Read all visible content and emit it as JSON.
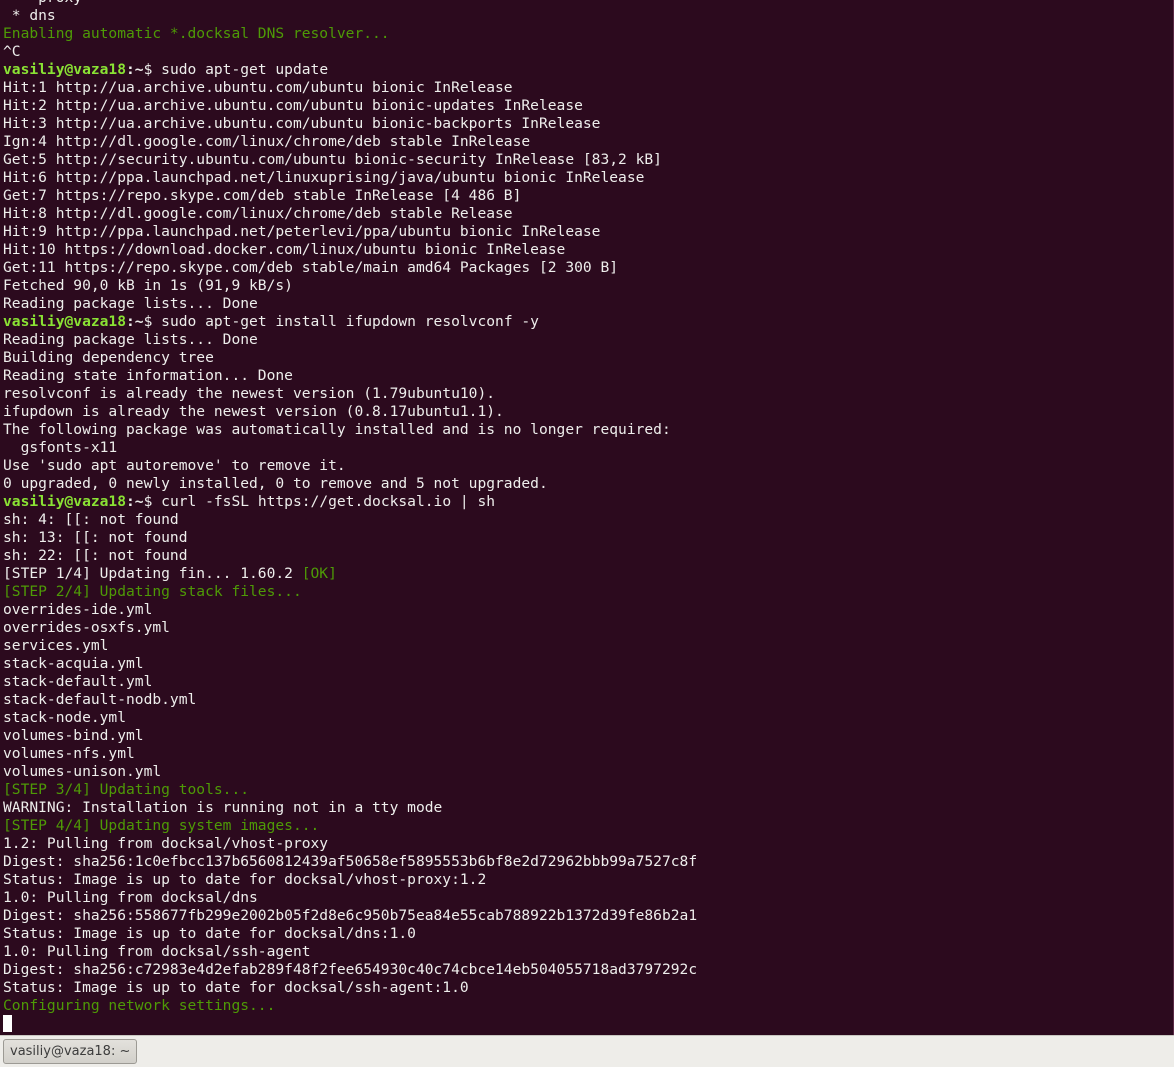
{
  "terminal": {
    "colors": {
      "background": "#2c0a1e",
      "text": "#eeeeec",
      "info": "#4e9a06",
      "prompt_user": "#8ae234"
    },
    "lines": [
      {
        "segments": [
          {
            "t": "    proxy",
            "c": "normal"
          }
        ]
      },
      {
        "segments": [
          {
            "t": " * dns",
            "c": "normal"
          }
        ]
      },
      {
        "segments": [
          {
            "t": "Enabling automatic *.docksal DNS resolver...",
            "c": "green"
          }
        ]
      },
      {
        "segments": [
          {
            "t": "^C",
            "c": "normal"
          }
        ]
      },
      {
        "segments": [
          {
            "t": "vasiliy@vaza18",
            "c": "prompt-user"
          },
          {
            "t": ":~",
            "c": "prompt-path"
          },
          {
            "t": "$ sudo apt-get update",
            "c": "normal"
          }
        ]
      },
      {
        "segments": [
          {
            "t": "Hit:1 http://ua.archive.ubuntu.com/ubuntu bionic InRelease",
            "c": "normal"
          }
        ]
      },
      {
        "segments": [
          {
            "t": "Hit:2 http://ua.archive.ubuntu.com/ubuntu bionic-updates InRelease",
            "c": "normal"
          }
        ]
      },
      {
        "segments": [
          {
            "t": "Hit:3 http://ua.archive.ubuntu.com/ubuntu bionic-backports InRelease",
            "c": "normal"
          }
        ]
      },
      {
        "segments": [
          {
            "t": "Ign:4 http://dl.google.com/linux/chrome/deb stable InRelease",
            "c": "normal"
          }
        ]
      },
      {
        "segments": [
          {
            "t": "Get:5 http://security.ubuntu.com/ubuntu bionic-security InRelease [83,2 kB]",
            "c": "normal"
          }
        ]
      },
      {
        "segments": [
          {
            "t": "Hit:6 http://ppa.launchpad.net/linuxuprising/java/ubuntu bionic InRelease",
            "c": "normal"
          }
        ]
      },
      {
        "segments": [
          {
            "t": "Get:7 https://repo.skype.com/deb stable InRelease [4 486 B]",
            "c": "normal"
          }
        ]
      },
      {
        "segments": [
          {
            "t": "Hit:8 http://dl.google.com/linux/chrome/deb stable Release",
            "c": "normal"
          }
        ]
      },
      {
        "segments": [
          {
            "t": "Hit:9 http://ppa.launchpad.net/peterlevi/ppa/ubuntu bionic InRelease",
            "c": "normal"
          }
        ]
      },
      {
        "segments": [
          {
            "t": "Hit:10 https://download.docker.com/linux/ubuntu bionic InRelease",
            "c": "normal"
          }
        ]
      },
      {
        "segments": [
          {
            "t": "Get:11 https://repo.skype.com/deb stable/main amd64 Packages [2 300 B]",
            "c": "normal"
          }
        ]
      },
      {
        "segments": [
          {
            "t": "Fetched 90,0 kB in 1s (91,9 kB/s)",
            "c": "normal"
          }
        ]
      },
      {
        "segments": [
          {
            "t": "Reading package lists... Done",
            "c": "normal"
          }
        ]
      },
      {
        "segments": [
          {
            "t": "vasiliy@vaza18",
            "c": "prompt-user"
          },
          {
            "t": ":~",
            "c": "prompt-path"
          },
          {
            "t": "$ sudo apt-get install ifupdown resolvconf -y",
            "c": "normal"
          }
        ]
      },
      {
        "segments": [
          {
            "t": "Reading package lists... Done",
            "c": "normal"
          }
        ]
      },
      {
        "segments": [
          {
            "t": "Building dependency tree",
            "c": "normal"
          }
        ]
      },
      {
        "segments": [
          {
            "t": "Reading state information... Done",
            "c": "normal"
          }
        ]
      },
      {
        "segments": [
          {
            "t": "resolvconf is already the newest version (1.79ubuntu10).",
            "c": "normal"
          }
        ]
      },
      {
        "segments": [
          {
            "t": "ifupdown is already the newest version (0.8.17ubuntu1.1).",
            "c": "normal"
          }
        ]
      },
      {
        "segments": [
          {
            "t": "The following package was automatically installed and is no longer required:",
            "c": "normal"
          }
        ]
      },
      {
        "segments": [
          {
            "t": "  gsfonts-x11",
            "c": "normal"
          }
        ]
      },
      {
        "segments": [
          {
            "t": "Use 'sudo apt autoremove' to remove it.",
            "c": "normal"
          }
        ]
      },
      {
        "segments": [
          {
            "t": "0 upgraded, 0 newly installed, 0 to remove and 5 not upgraded.",
            "c": "normal"
          }
        ]
      },
      {
        "segments": [
          {
            "t": "vasiliy@vaza18",
            "c": "prompt-user"
          },
          {
            "t": ":~",
            "c": "prompt-path"
          },
          {
            "t": "$ curl -fsSL https://get.docksal.io | sh",
            "c": "normal"
          }
        ]
      },
      {
        "segments": [
          {
            "t": "sh: 4: [[: not found",
            "c": "normal"
          }
        ]
      },
      {
        "segments": [
          {
            "t": "sh: 13: [[: not found",
            "c": "normal"
          }
        ]
      },
      {
        "segments": [
          {
            "t": "sh: 22: [[: not found",
            "c": "normal"
          }
        ]
      },
      {
        "segments": [
          {
            "t": "[STEP 1/4] Updating fin... 1.60.2 ",
            "c": "normal"
          },
          {
            "t": "[OK]",
            "c": "green"
          }
        ]
      },
      {
        "segments": [
          {
            "t": "[STEP 2/4] Updating stack files...",
            "c": "green"
          }
        ]
      },
      {
        "segments": [
          {
            "t": "overrides-ide.yml",
            "c": "normal"
          }
        ]
      },
      {
        "segments": [
          {
            "t": "overrides-osxfs.yml",
            "c": "normal"
          }
        ]
      },
      {
        "segments": [
          {
            "t": "services.yml",
            "c": "normal"
          }
        ]
      },
      {
        "segments": [
          {
            "t": "stack-acquia.yml",
            "c": "normal"
          }
        ]
      },
      {
        "segments": [
          {
            "t": "stack-default.yml",
            "c": "normal"
          }
        ]
      },
      {
        "segments": [
          {
            "t": "stack-default-nodb.yml",
            "c": "normal"
          }
        ]
      },
      {
        "segments": [
          {
            "t": "stack-node.yml",
            "c": "normal"
          }
        ]
      },
      {
        "segments": [
          {
            "t": "volumes-bind.yml",
            "c": "normal"
          }
        ]
      },
      {
        "segments": [
          {
            "t": "volumes-nfs.yml",
            "c": "normal"
          }
        ]
      },
      {
        "segments": [
          {
            "t": "volumes-unison.yml",
            "c": "normal"
          }
        ]
      },
      {
        "segments": [
          {
            "t": "[STEP 3/4] Updating tools...",
            "c": "green"
          }
        ]
      },
      {
        "segments": [
          {
            "t": "WARNING: Installation is running not in a tty mode",
            "c": "normal"
          }
        ]
      },
      {
        "segments": [
          {
            "t": "[STEP 4/4] Updating system images...",
            "c": "green"
          }
        ]
      },
      {
        "segments": [
          {
            "t": "1.2: Pulling from docksal/vhost-proxy",
            "c": "normal"
          }
        ]
      },
      {
        "segments": [
          {
            "t": "Digest: sha256:1c0efbcc137b6560812439af50658ef5895553b6bf8e2d72962bbb99a7527c8f",
            "c": "normal"
          }
        ]
      },
      {
        "segments": [
          {
            "t": "Status: Image is up to date for docksal/vhost-proxy:1.2",
            "c": "normal"
          }
        ]
      },
      {
        "segments": [
          {
            "t": "1.0: Pulling from docksal/dns",
            "c": "normal"
          }
        ]
      },
      {
        "segments": [
          {
            "t": "Digest: sha256:558677fb299e2002b05f2d8e6c950b75ea84e55cab788922b1372d39fe86b2a1",
            "c": "normal"
          }
        ]
      },
      {
        "segments": [
          {
            "t": "Status: Image is up to date for docksal/dns:1.0",
            "c": "normal"
          }
        ]
      },
      {
        "segments": [
          {
            "t": "1.0: Pulling from docksal/ssh-agent",
            "c": "normal"
          }
        ]
      },
      {
        "segments": [
          {
            "t": "Digest: sha256:c72983e4d2efab289f48f2fee654930c40c74cbce14eb504055718ad3797292c",
            "c": "normal"
          }
        ]
      },
      {
        "segments": [
          {
            "t": "Status: Image is up to date for docksal/ssh-agent:1.0",
            "c": "normal"
          }
        ]
      },
      {
        "segments": [
          {
            "t": "Configuring network settings...",
            "c": "green"
          }
        ]
      }
    ]
  },
  "taskbar": {
    "window_button_label": "vasiliy@vaza18: ~"
  }
}
